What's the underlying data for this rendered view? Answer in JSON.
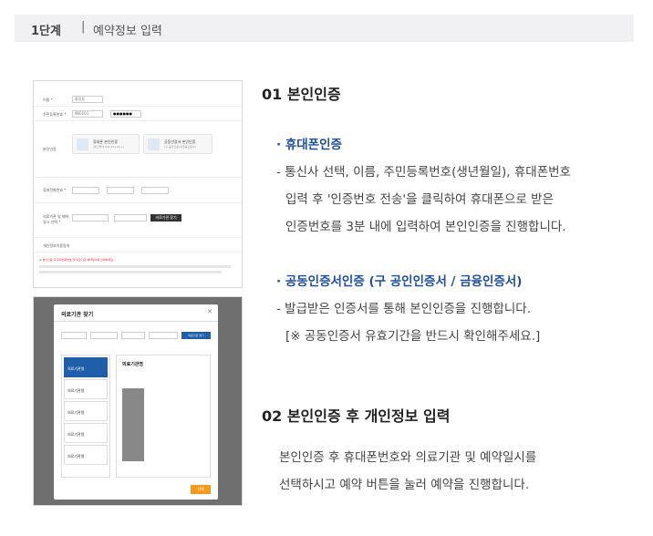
{
  "step_bar": {
    "step": "1단계",
    "separator": "|",
    "title": "예약정보 입력"
  },
  "section1": {
    "heading": "01 본인인증",
    "mobile": {
      "title": "· 휴대폰인증",
      "lines": [
        "- 통신사 선택, 이름, 주민등록번호(생년월일), 휴대폰번호",
        "입력 후 '인증번호 전송'을 클릭하여 휴대폰으로 받은",
        "인증번호를 3분 내에 입력하여 본인인증을 진행합니다."
      ]
    },
    "certificate": {
      "title": "· 공동인증서인증 (구 공인인증서 / 금융인증서)",
      "lines": [
        "- 발급받은 인증서를 통해 본인인증을 진행합니다.",
        "[※ 공동인증서 유효기간을 반드시 확인해주세요.]"
      ]
    }
  },
  "section2": {
    "heading": "02 본인인증 후 개인정보 입력",
    "lines": [
      "본인인증 후 휴대폰번호와 의료기관 및 예약일시를",
      "선택하시고 예약 버튼을 눌러 예약을 진행합니다."
    ]
  },
  "thumb1": {
    "name_label": "이름 *",
    "name_value": "홍길동",
    "rrn_label": "주민등록번호 *",
    "rrn_value": "960101",
    "rrn_masked": "●●●●●●",
    "auth_label": "본인인증",
    "mobile_card": "휴대폰 본인인증",
    "mobile_card_sub": "(본인명의 SKT,KT,LGU+)",
    "cert_card": "공동인증서 본인인증",
    "cert_card_sub": "(구 공인인증서/금융인증서)",
    "phone_label": "휴대전화번호 *",
    "org_label": "의료기관 및 예약일시 선택 *",
    "org_button": "의료기관 찾기",
    "privacy_label": "개인정보이용동의",
    "notice": "※ 본인인증 후 휴대전화번호 및 의료기관 예약일시를 선택하세요."
  },
  "thumb2": {
    "modal_title": "의료기관 찾기",
    "close": "✕",
    "search_button": "의료기관 찾기",
    "item_label": "의료기관명",
    "detail_title": "의료기관명",
    "confirm": "선택"
  }
}
